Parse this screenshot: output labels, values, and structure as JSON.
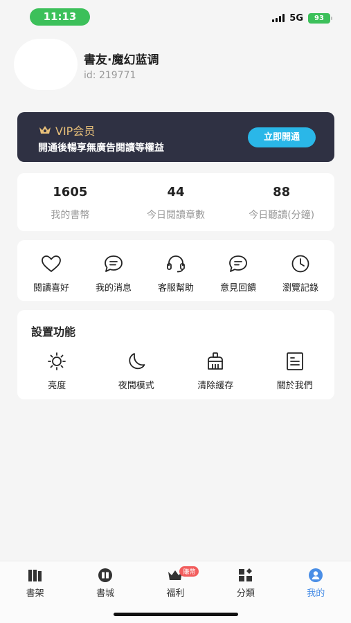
{
  "status_bar": {
    "time": "11:13",
    "network": "5G",
    "battery": "93"
  },
  "profile": {
    "name": "書友·魔幻蓝调",
    "id_text": "id: 219771"
  },
  "vip": {
    "title": "VIP会员",
    "subtitle": "開通後暢享無廣告閱讀等權益",
    "button": "立即開通",
    "accent_color": "#e8c07a",
    "button_color": "#2ab7e8"
  },
  "stats": [
    {
      "value": "1605",
      "label": "我的書幣"
    },
    {
      "value": "44",
      "label": "今日閱讀章數"
    },
    {
      "value": "88",
      "label": "今日聽讀(分鐘)"
    }
  ],
  "quick_actions": [
    {
      "label": "閱讀喜好",
      "icon": "heart-icon"
    },
    {
      "label": "我的消息",
      "icon": "message-icon"
    },
    {
      "label": "客服幫助",
      "icon": "headset-icon"
    },
    {
      "label": "意見回饋",
      "icon": "feedback-icon"
    },
    {
      "label": "瀏覽記錄",
      "icon": "clock-icon"
    }
  ],
  "settings": {
    "title": "設置功能",
    "items": [
      {
        "label": "亮度",
        "icon": "brightness-icon"
      },
      {
        "label": "夜間模式",
        "icon": "moon-icon"
      },
      {
        "label": "清除緩存",
        "icon": "broom-icon"
      },
      {
        "label": "關於我們",
        "icon": "document-icon"
      }
    ]
  },
  "tabbar": {
    "items": [
      {
        "label": "書架",
        "icon": "bookshelf-icon"
      },
      {
        "label": "書城",
        "icon": "bookstore-icon"
      },
      {
        "label": "福利",
        "icon": "crown-icon",
        "badge": "賺幣"
      },
      {
        "label": "分類",
        "icon": "category-icon"
      },
      {
        "label": "我的",
        "icon": "user-icon",
        "active": true
      }
    ],
    "active_color": "#4a8ee6"
  }
}
